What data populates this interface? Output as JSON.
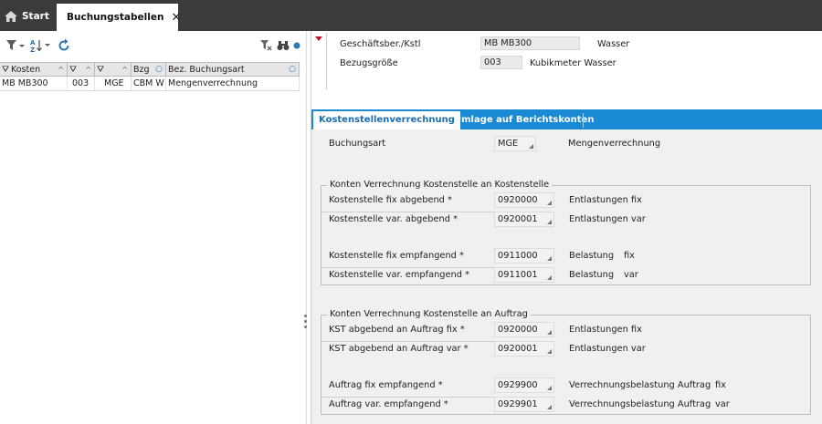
{
  "tabs": {
    "start_label": "Start",
    "active_label": "Buchungstabellen"
  },
  "grid": {
    "columns": [
      "Kosten",
      "",
      "",
      "Bzg",
      "Bez. Buchungsart"
    ],
    "rows": [
      [
        "MB MB300",
        "003",
        "MGE",
        "CBM W",
        "Mengenverrechnung"
      ]
    ]
  },
  "header": {
    "geschaeftsber_label": "Geschäftsber./Kstl",
    "geschaeftsber_value": "MB MB300",
    "geschaeftsber_desc": "Wasser",
    "bezugsgroesse_label": "Bezugsgröße",
    "bezugsgroesse_value": "003",
    "bezugsgroesse_desc": "Kubikmeter Wasser"
  },
  "subtabs": {
    "tab1": "Kostenstellenverrechnung",
    "tab2": "Umlage auf Berichtskonten"
  },
  "buchungsart": {
    "label": "Buchungsart",
    "value": "MGE",
    "desc": "Mengenverrechnung"
  },
  "group1": {
    "title": "Konten Verrechnung Kostenstelle an Kostenstelle",
    "rows": [
      {
        "label": "Kostenstelle fix abgebend *",
        "value": "0920000",
        "desc": "Entlastungen fix",
        "desc2": ""
      },
      {
        "label": "Kostenstelle var. abgebend *",
        "value": "0920001",
        "desc": "Entlastungen var",
        "desc2": ""
      },
      {
        "label": "Kostenstelle fix empfangend *",
        "value": "0911000",
        "desc": "Belastung",
        "desc2": "fix"
      },
      {
        "label": "Kostenstelle var. empfangend *",
        "value": "0911001",
        "desc": "Belastung",
        "desc2": "var"
      }
    ]
  },
  "group2": {
    "title": "Konten Verrechnung Kostenstelle an Auftrag",
    "rows": [
      {
        "label": "KST abgebend an Auftrag fix *",
        "value": "0920000",
        "desc": "Entlastungen fix",
        "desc2": ""
      },
      {
        "label": "KST abgebend an Auftrag var *",
        "value": "0920001",
        "desc": "Entlastungen var",
        "desc2": ""
      },
      {
        "label": "Auftrag fix empfangend *",
        "value": "0929900",
        "desc": "Verrechnungsbelastung Auftrag",
        "desc2": "fix"
      },
      {
        "label": "Auftrag var. empfangend *",
        "value": "0929901",
        "desc": "Verrechnungsbelastung Auftrag",
        "desc2": "var"
      }
    ]
  },
  "colors": {
    "topbar": "#3b3b3b",
    "accent": "#1a8ad4",
    "marker": "#c0102a"
  }
}
